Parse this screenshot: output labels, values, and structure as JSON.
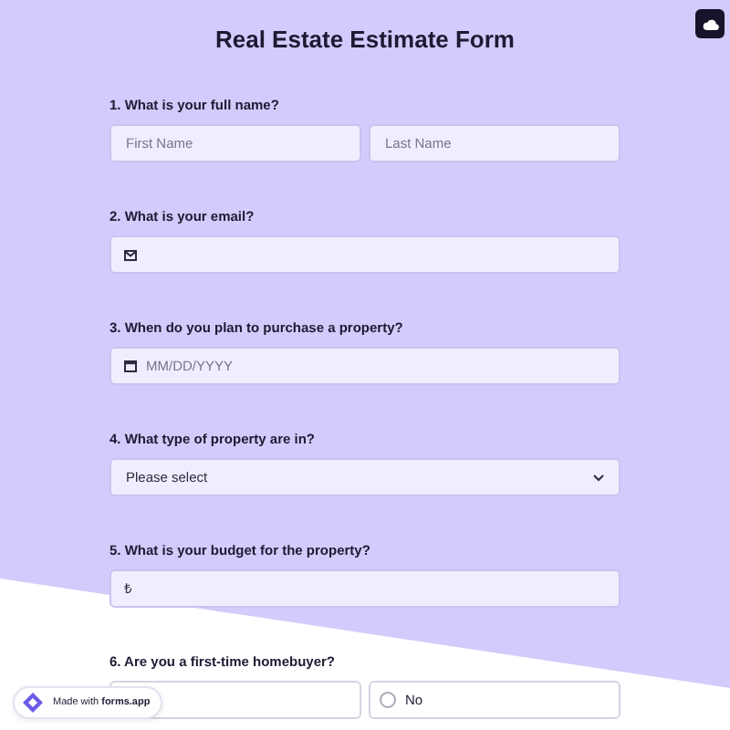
{
  "title": "Real Estate Estimate Form",
  "questions": [
    {
      "kind": "name",
      "label": "1.  What is your full name?",
      "placeholders": [
        "First Name",
        "Last Name"
      ]
    },
    {
      "kind": "email",
      "label": "2. What is your email?"
    },
    {
      "kind": "date",
      "label": "3. When do you plan to purchase a property?",
      "placeholder": "MM/DD/YYYY"
    },
    {
      "kind": "select",
      "label": "4. What type of property are in?",
      "value": "Please select"
    },
    {
      "kind": "money",
      "label": "5. What is your budget for the property?",
      "prefix": "₺"
    },
    {
      "kind": "radio",
      "label": "6. Are you a first-time homebuyer?",
      "options": [
        {
          "kind": "blank"
        },
        {
          "kind": "labeled",
          "label": "No",
          "selected": false
        }
      ]
    }
  ],
  "badge": {
    "text": "Made with **forms.app**"
  }
}
